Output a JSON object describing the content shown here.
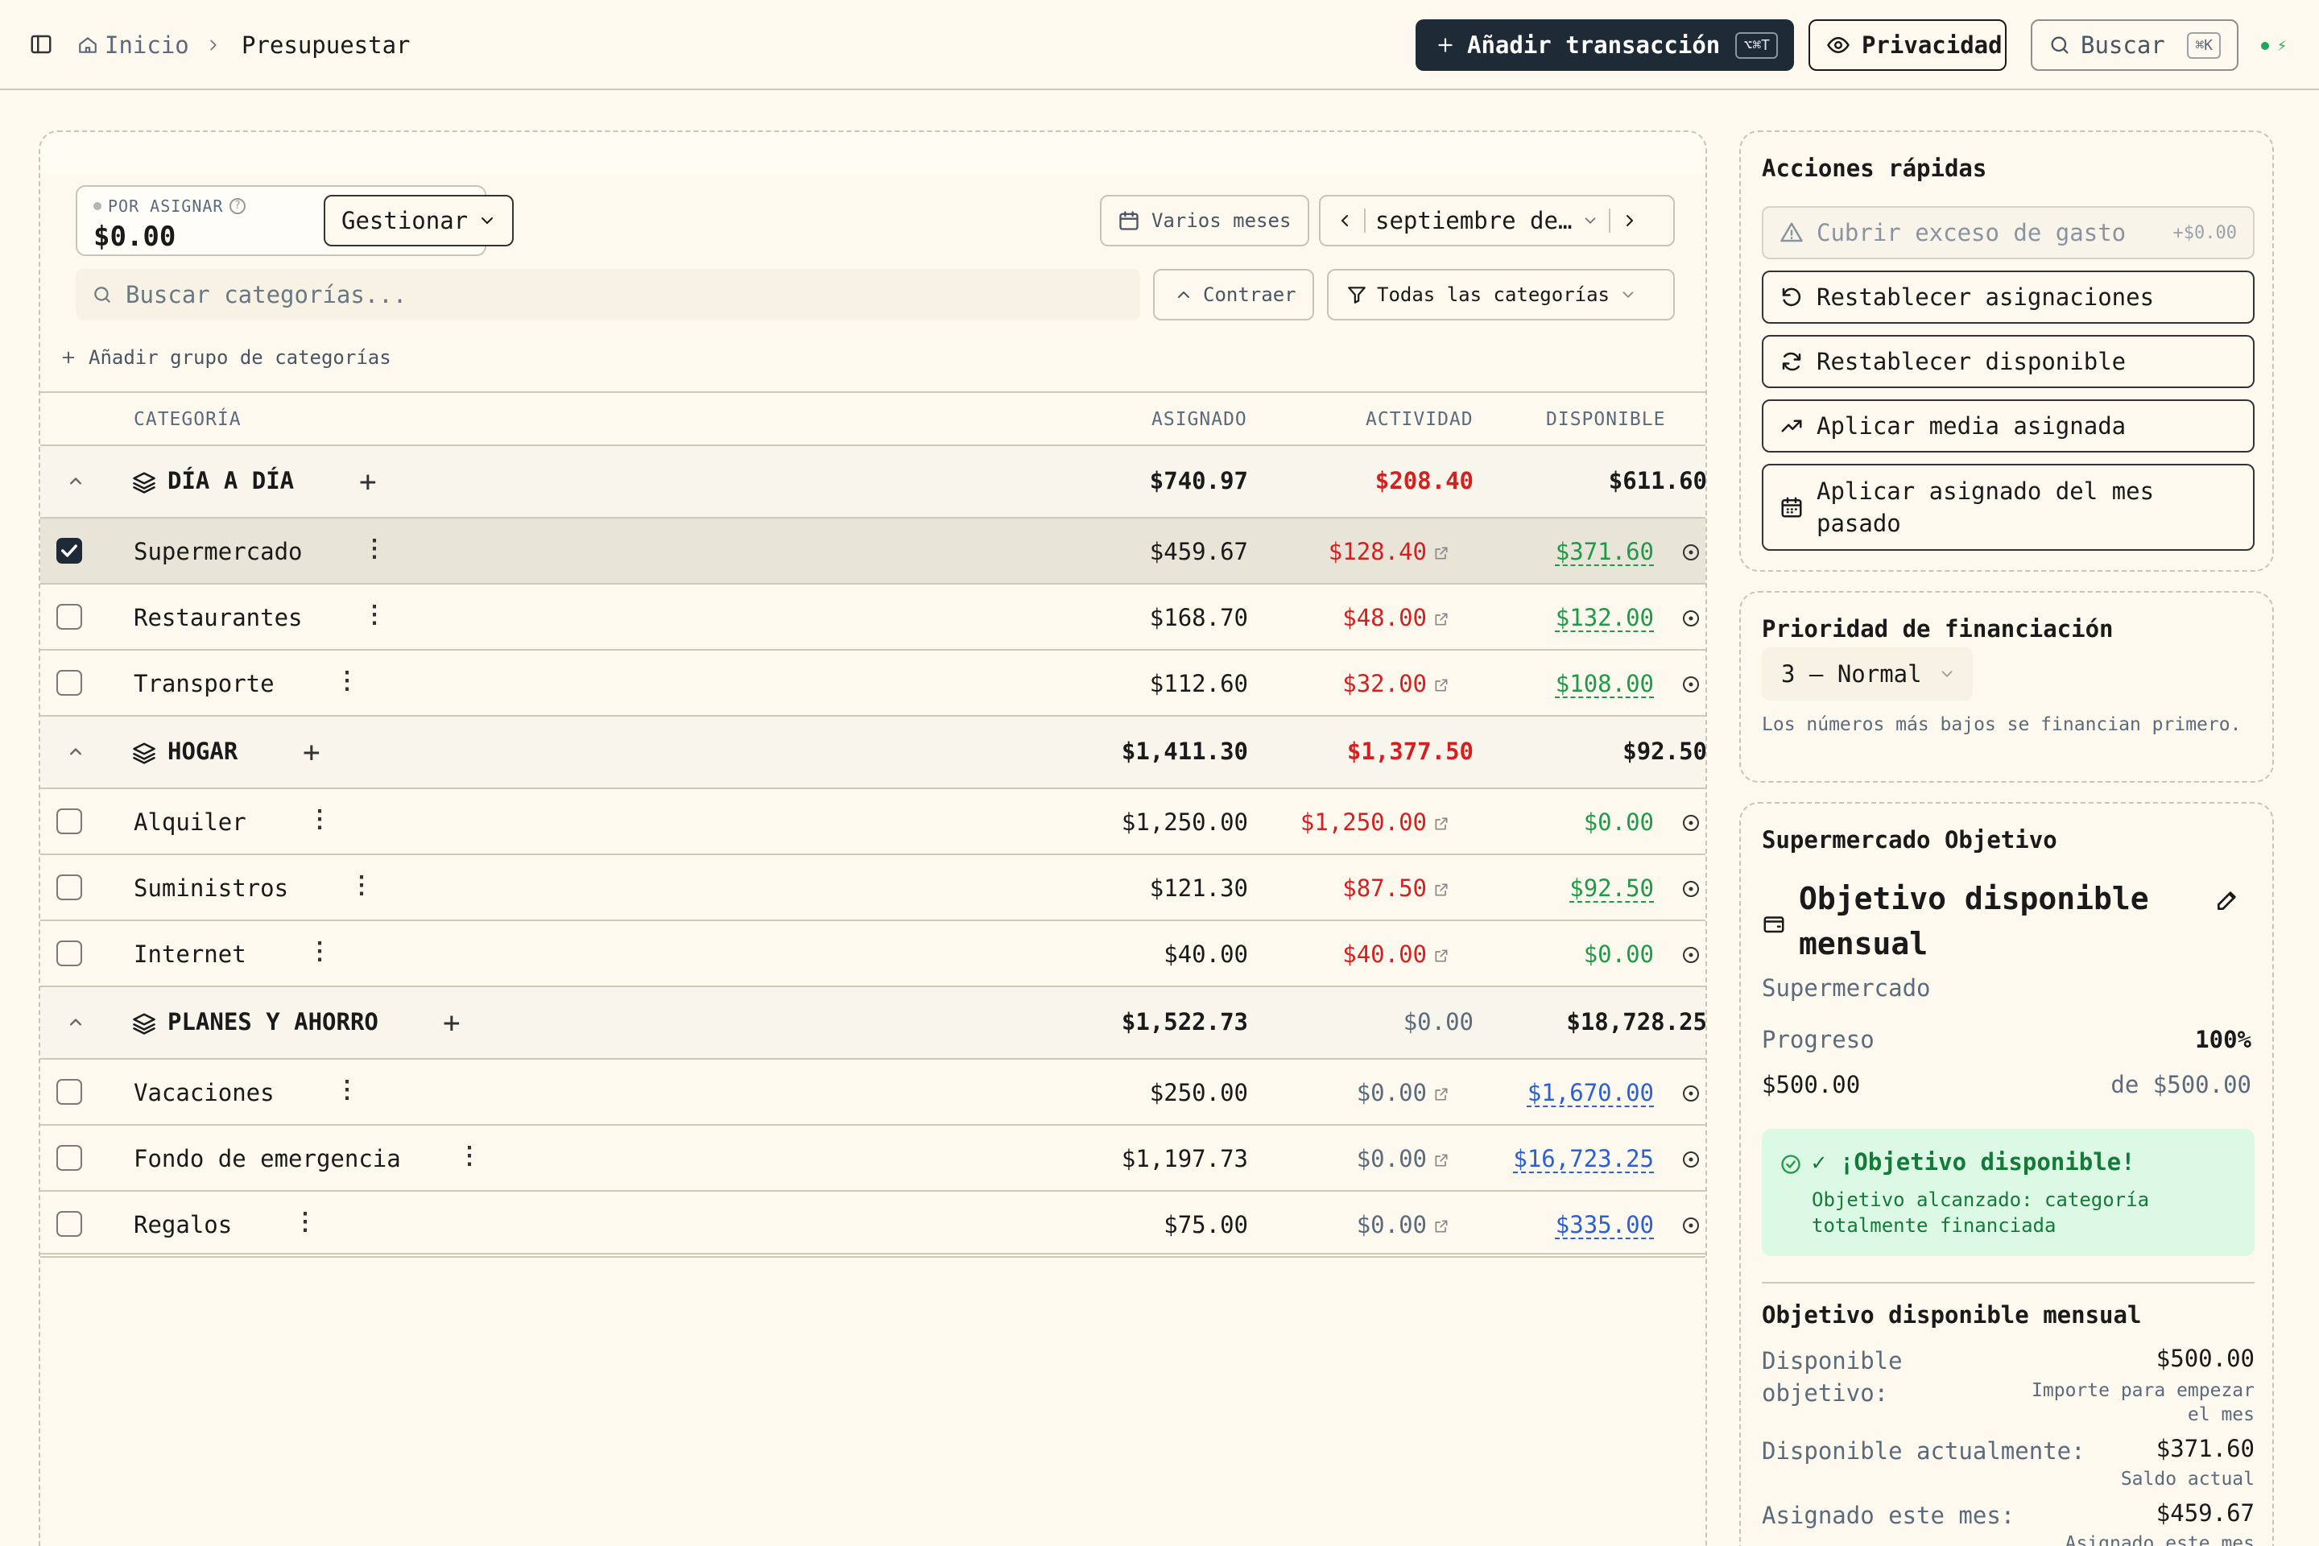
{
  "header": {
    "breadcrumb_home": "Inicio",
    "breadcrumb_current": "Presupuestar",
    "add_transaction": "Añadir transacción",
    "add_transaction_kbd": "⌥⌘T",
    "privacy": "Privacidad",
    "search": "Buscar",
    "search_kbd": "⌘K"
  },
  "budget": {
    "to_assign_label": "POR ASIGNAR",
    "to_assign_value": "$0.00",
    "manage": "Gestionar",
    "multi_month": "Varios meses",
    "month": "septiembre de…",
    "search_placeholder": "Buscar categorías...",
    "collapse": "Contraer",
    "all_categories": "Todas las categorías",
    "add_group": "Añadir grupo de categorías"
  },
  "table": {
    "headers": {
      "category": "CATEGORÍA",
      "assigned": "ASIGNADO",
      "activity": "ACTIVIDAD",
      "available": "DISPONIBLE"
    },
    "groups": [
      {
        "name": "DÍA A DÍA",
        "assigned": "$740.97",
        "activity": "$208.40",
        "available": "$611.60",
        "categories": [
          {
            "name": "Supermercado",
            "assigned": "$459.67",
            "activity": "$128.40",
            "available": "$371.60",
            "selected": true
          },
          {
            "name": "Restaurantes",
            "assigned": "$168.70",
            "activity": "$48.00",
            "available": "$132.00"
          },
          {
            "name": "Transporte",
            "assigned": "$112.60",
            "activity": "$32.00",
            "available": "$108.00"
          }
        ]
      },
      {
        "name": "HOGAR",
        "assigned": "$1,411.30",
        "activity": "$1,377.50",
        "available": "$92.50",
        "categories": [
          {
            "name": "Alquiler",
            "assigned": "$1,250.00",
            "activity": "$1,250.00",
            "available": "$0.00"
          },
          {
            "name": "Suministros",
            "assigned": "$121.30",
            "activity": "$87.50",
            "available": "$92.50"
          },
          {
            "name": "Internet",
            "assigned": "$40.00",
            "activity": "$40.00",
            "available": "$0.00"
          }
        ]
      },
      {
        "name": "PLANES Y AHORRO",
        "assigned": "$1,522.73",
        "activity": "$0.00",
        "available": "$18,728.25",
        "categories": [
          {
            "name": "Vacaciones",
            "assigned": "$250.00",
            "activity": "$0.00",
            "available": "$1,670.00"
          },
          {
            "name": "Fondo de emergencia",
            "assigned": "$1,197.73",
            "activity": "$0.00",
            "available": "$16,723.25"
          },
          {
            "name": "Regalos",
            "assigned": "$75.00",
            "activity": "$0.00",
            "available": "$335.00"
          }
        ]
      }
    ]
  },
  "quick_actions": {
    "title": "Acciones rápidas",
    "cover_overspend": "Cubrir exceso de gasto",
    "cover_overspend_amount": "+$0.00",
    "reset_assigned": "Restablecer asignaciones",
    "reset_available": "Restablecer disponible",
    "apply_avg": "Aplicar media asignada",
    "apply_last_month": "Aplicar asignado del mes pasado"
  },
  "priority": {
    "title": "Prioridad de financiación",
    "value": "3 — Normal",
    "note": "Los números más bajos se financian primero."
  },
  "goal": {
    "title": "Supermercado Objetivo",
    "type": "Objetivo disponible mensual",
    "category": "Supermercado",
    "progress_label": "Progreso",
    "progress_value": "100%",
    "current": "$500.00",
    "target": "de $500.00",
    "success_title": "✓ ¡Objetivo disponible!",
    "success_text": "Objetivo alcanzado: categoría totalmente financiada",
    "detail_title": "Objetivo disponible mensual",
    "target_label": "Disponible objetivo:",
    "target_value": "$500.00",
    "target_sub": "Importe para empezar el mes",
    "current_label": "Disponible actualmente:",
    "current_value": "$371.60",
    "current_sub": "Saldo actual",
    "assigned_label": "Asignado este mes:",
    "assigned_value": "$459.67",
    "assigned_sub": "Asignado este mes"
  },
  "colors": {
    "accent_dark": "#1f2a37",
    "negative": "#d61f1f",
    "positive": "#1f9a48",
    "savings": "#2c5fd6",
    "background": "#fdf9ee"
  }
}
